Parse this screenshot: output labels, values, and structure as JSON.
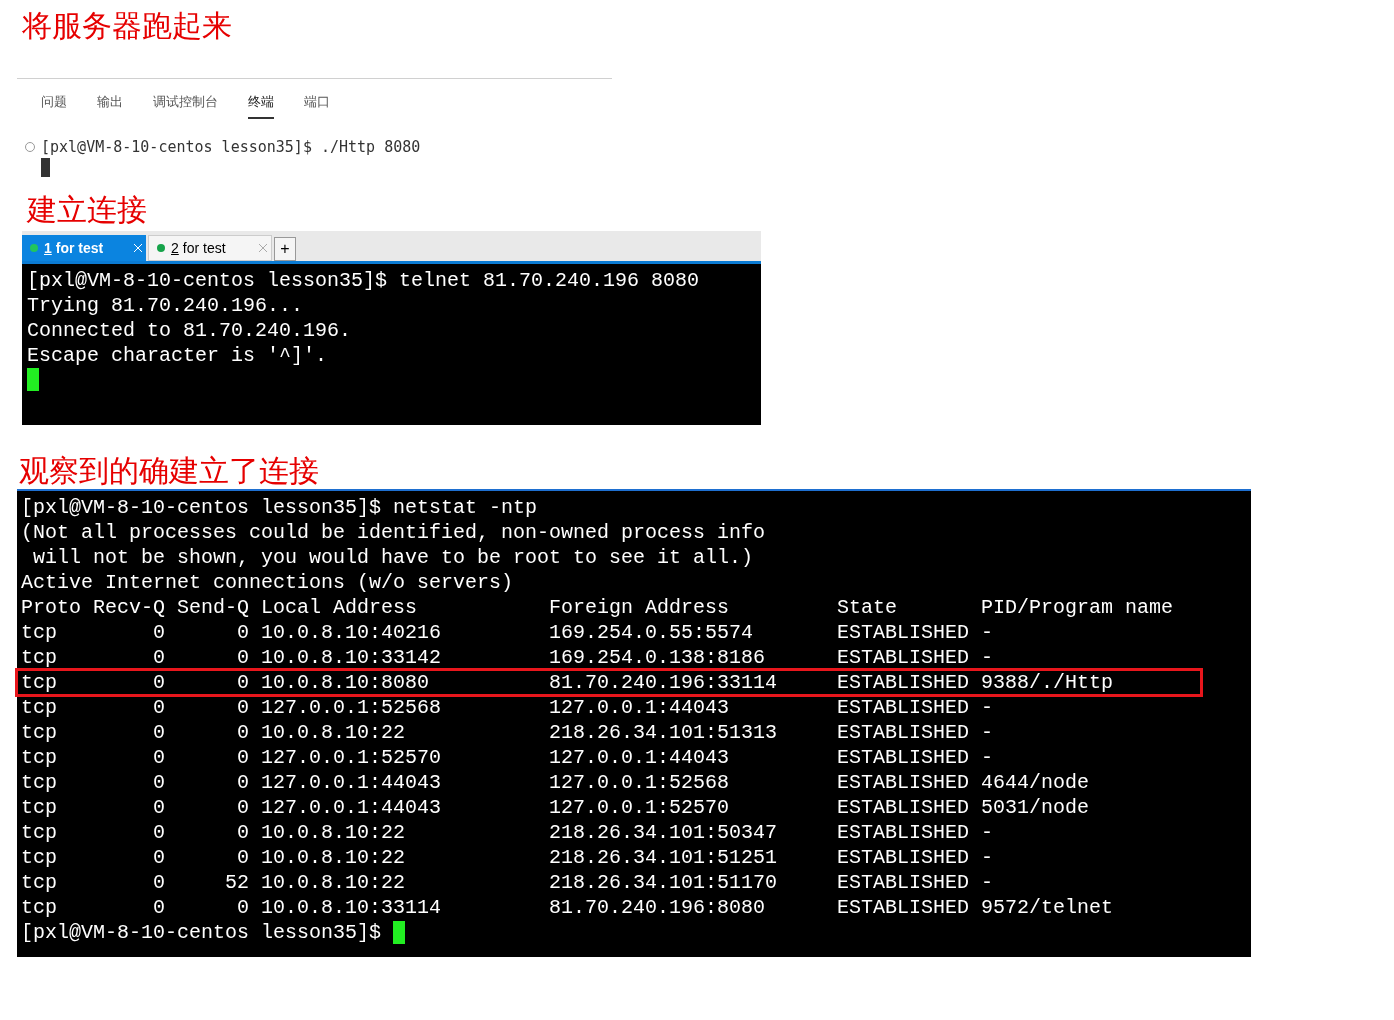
{
  "sections": [
    {
      "kind": "vscode",
      "heading": "将服务器跑起来",
      "tabs": [
        {
          "label": "问题",
          "selected": false
        },
        {
          "label": "输出",
          "selected": false
        },
        {
          "label": "调试控制台",
          "selected": false
        },
        {
          "label": "终端",
          "selected": true
        },
        {
          "label": "端口",
          "selected": false
        }
      ],
      "lines": [
        "[pxl@VM-8-10-centos lesson35]$ ./Http 8080"
      ]
    },
    {
      "kind": "xshell",
      "heading": "建立连接",
      "tabs": [
        {
          "number": "1",
          "label": "for test",
          "selected": true,
          "color": "#22c55e"
        },
        {
          "number": "2",
          "label": "for test",
          "selected": false,
          "color": "#16a34a"
        }
      ],
      "new_tab": "+",
      "lines": [
        "[pxl@VM-8-10-centos lesson35]$ telnet 81.70.240.196 8080",
        "Trying 81.70.240.196...",
        "Connected to 81.70.240.196.",
        "Escape character is '^]'."
      ]
    },
    {
      "kind": "netstat",
      "heading": "观察到的确建立了连接",
      "lines": [
        "[pxl@VM-8-10-centos lesson35]$ netstat -ntp",
        "(Not all processes could be identified, non-owned process info",
        " will not be shown, you would have to be root to see it all.)",
        "Active Internet connections (w/o servers)"
      ],
      "columns": [
        "Proto",
        "Recv-Q",
        "Send-Q",
        "Local Address",
        "Foreign Address",
        "State",
        "PID/Program name"
      ],
      "rows": [
        {
          "cells": [
            "tcp",
            "0",
            "0",
            "10.0.8.10:40216",
            "169.254.0.55:5574",
            "ESTABLISHED",
            "-"
          ],
          "highlighted": false
        },
        {
          "cells": [
            "tcp",
            "0",
            "0",
            "10.0.8.10:33142",
            "169.254.0.138:8186",
            "ESTABLISHED",
            "-"
          ],
          "highlighted": false
        },
        {
          "cells": [
            "tcp",
            "0",
            "0",
            "10.0.8.10:8080",
            "81.70.240.196:33114",
            "ESTABLISHED",
            "9388/./Http"
          ],
          "highlighted": true
        },
        {
          "cells": [
            "tcp",
            "0",
            "0",
            "127.0.0.1:52568",
            "127.0.0.1:44043",
            "ESTABLISHED",
            "-"
          ],
          "highlighted": false
        },
        {
          "cells": [
            "tcp",
            "0",
            "0",
            "10.0.8.10:22",
            "218.26.34.101:51313",
            "ESTABLISHED",
            "-"
          ],
          "highlighted": false
        },
        {
          "cells": [
            "tcp",
            "0",
            "0",
            "127.0.0.1:52570",
            "127.0.0.1:44043",
            "ESTABLISHED",
            "-"
          ],
          "highlighted": false
        },
        {
          "cells": [
            "tcp",
            "0",
            "0",
            "127.0.0.1:44043",
            "127.0.0.1:52568",
            "ESTABLISHED",
            "4644/node"
          ],
          "highlighted": false
        },
        {
          "cells": [
            "tcp",
            "0",
            "0",
            "127.0.0.1:44043",
            "127.0.0.1:52570",
            "ESTABLISHED",
            "5031/node"
          ],
          "highlighted": false
        },
        {
          "cells": [
            "tcp",
            "0",
            "0",
            "10.0.8.10:22",
            "218.26.34.101:50347",
            "ESTABLISHED",
            "-"
          ],
          "highlighted": false
        },
        {
          "cells": [
            "tcp",
            "0",
            "0",
            "10.0.8.10:22",
            "218.26.34.101:51251",
            "ESTABLISHED",
            "-"
          ],
          "highlighted": false
        },
        {
          "cells": [
            "tcp",
            "0",
            "52",
            "10.0.8.10:22",
            "218.26.34.101:51170",
            "ESTABLISHED",
            "-"
          ],
          "highlighted": false
        },
        {
          "cells": [
            "tcp",
            "0",
            "0",
            "10.0.8.10:33114",
            "81.70.240.196:8080",
            "ESTABLISHED",
            "9572/telnet"
          ],
          "highlighted": false
        }
      ],
      "prompt": "[pxl@VM-8-10-centos lesson35]$"
    }
  ]
}
